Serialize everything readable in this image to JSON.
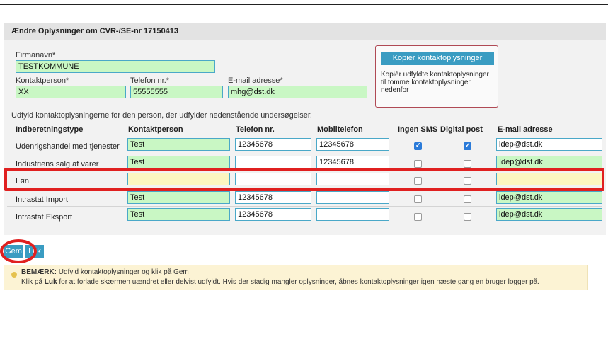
{
  "panel_title": "Ændre Oplysninger om CVR-/SE-nr 17150413",
  "company": {
    "firmanavn_label": "Firmanavn*",
    "firmanavn_value": "TESTKOMMUNE",
    "contact_label": "Kontaktperson*",
    "contact_value": "XX",
    "phone_label": "Telefon nr.*",
    "phone_value": "55555555",
    "email_label": "E-mail adresse*",
    "email_value": "mhg@dst.dk"
  },
  "copy_box": {
    "button_label": "Kopier kontaktoplysninger",
    "description": "Kopiér udfyldte kontaktoplysninger til tomme kontaktoplysninger nedenfor"
  },
  "instruction": "Udfyld kontaktoplysningerne for den person, der udfylder nedenstående undersøgelser.",
  "table": {
    "headers": {
      "type": "Indberetningstype",
      "contact": "Kontaktperson",
      "phone": "Telefon nr.",
      "mobile": "Mobiltelefon",
      "sms": "Ingen SMS",
      "post": "Digital post",
      "email": "E-mail adresse"
    },
    "rows": [
      {
        "type": "Udenrigshandel med tjenester",
        "contact": "Test",
        "phone": "12345678",
        "mobile": "12345678",
        "sms": true,
        "post": true,
        "email": "idep@dst.dk"
      },
      {
        "type": "Industriens salg af varer",
        "contact": "Test",
        "phone": "",
        "mobile": "12345678",
        "sms": false,
        "post": false,
        "email": "Idep@dst.dk"
      },
      {
        "type": "Løn",
        "contact": "",
        "phone": "",
        "mobile": "",
        "sms": false,
        "post": false,
        "email": ""
      },
      {
        "type": "Intrastat Import",
        "contact": "Test",
        "phone": "12345678",
        "mobile": "",
        "sms": false,
        "post": false,
        "email": "idep@dst.dk"
      },
      {
        "type": "Intrastat Eksport",
        "contact": "Test",
        "phone": "12345678",
        "mobile": "",
        "sms": false,
        "post": false,
        "email": "idep@dst.dk"
      }
    ]
  },
  "buttons": {
    "save": "Gem",
    "close": "Luk"
  },
  "note": {
    "line1_bold": "BEMÆRK:",
    "line1_rest": " Udfyld kontaktoplysninger og klik på Gem",
    "line2_pre": "Klik på ",
    "line2_bold": "Luk",
    "line2_rest": " for at forlade skærmen uændret eller delvist udfyldt. Hvis der stadig mangler oplysninger, åbnes kontaktoplysninger igen næste gang en bruger logger på."
  },
  "colors": {
    "accent": "#3a9cc2",
    "filled_field": "#c9f7c4",
    "empty_required_field": "#fcf6c1",
    "highlight": "#e02020"
  }
}
